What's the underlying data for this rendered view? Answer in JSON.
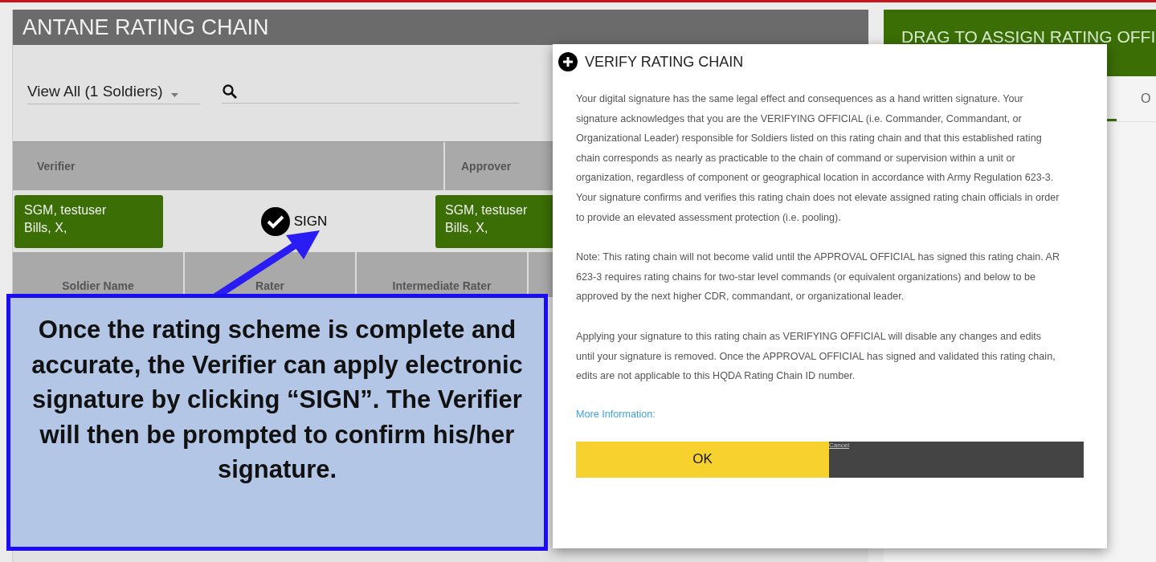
{
  "panel": {
    "title": "ANTANE RATING CHAIN"
  },
  "filter": {
    "value": "View All (1 Soldiers)"
  },
  "chain": {
    "columns": [
      "Verifier",
      "Approver"
    ],
    "verifier": {
      "rank_name": "SGM, testuser",
      "unit": "Bills, X,"
    },
    "sign": {
      "label": "SIGN",
      "checked": true
    },
    "approver": {
      "rank_name": "SGM, testuser",
      "unit": "Bills, X,"
    }
  },
  "table": {
    "columns": [
      "Soldier Name",
      "Rater",
      "Intermediate Rater"
    ]
  },
  "assign_panel": {
    "title": "DRAG TO ASSIGN RATING OFFI",
    "tabs": [
      {
        "label": "O",
        "selected": false
      }
    ]
  },
  "dialog": {
    "title": "VERIFY RATING CHAIN",
    "paragraphs": [
      "Your digital signature has the same legal effect and consequences as a hand written signature. Your signature acknowledges that you are the VERIFYING OFFICIAL (i.e. Commander, Commandant, or Organizational Leader) responsible for Soldiers listed on this rating chain and that this established rating chain corresponds as nearly as practicable to the chain of command or supervision within a unit or organization, regardless of component or geographical location in accordance with Army Regulation 623-3. Your signature confirms and verifies this rating chain does not elevate assigned rating chain officials in order to provide an elevated assessment protection (i.e. pooling).",
      "Note: This rating chain will not become valid until the APPROVAL OFFICIAL has signed this rating chain. AR 623-3 requires rating chains for two-star level commands (or equivalent organizations) and below to be approved by the next higher CDR, commandant, or organizational leader.",
      "Applying your signature to this rating chain as VERIFYING OFFICIAL will disable any changes and edits until your signature is removed. Once the APPROVAL OFFICIAL has signed and validated this rating chain, edits are not applicable to this HQDA Rating Chain ID number."
    ],
    "link": "More Information:",
    "ok": "OK",
    "cancel": "Cancel"
  },
  "callout": {
    "text": "Once the rating scheme is complete and accurate, the Verifier can apply electronic signature by clicking “SIGN”. The Verifier will then be prompted to confirm his/her signature."
  }
}
